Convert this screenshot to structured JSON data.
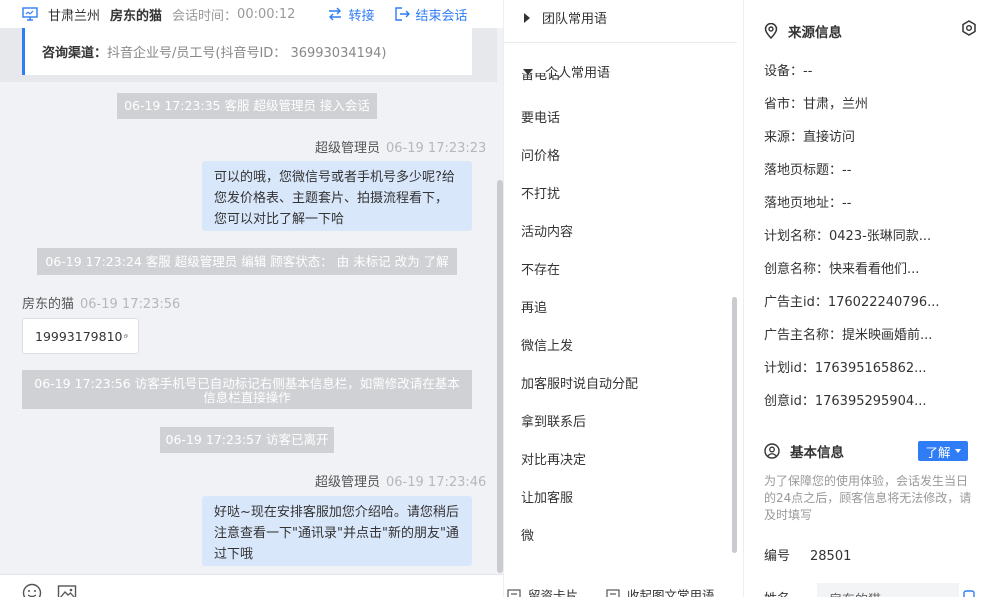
{
  "header": {
    "region": "甘肃兰州",
    "customer_name": "房东的猫",
    "session_time_label": "会话时间：",
    "session_time": "00:00:12",
    "transfer_label": "转接",
    "end_session_label": "结束会话"
  },
  "channel": {
    "label": "咨询渠道：",
    "value": "抖音企业号/员工号(抖音号ID： 36993034194)"
  },
  "messages": {
    "sys1": "06-19 17:23:35 客服 超级管理员 接入会话",
    "agent1": {
      "name": "超级管理员",
      "time": "06-19 17:23:23",
      "text": "可以的哦，您微信号或者手机号多少呢?给您发价格表、主题套片、拍摄流程看下，您可以对比了解一下哈"
    },
    "sys2": "06-19 17:23:24 客服 超级管理员 编辑 顾客状态： 由 未标记 改为 了解",
    "visitor1": {
      "name": "房东的猫",
      "time": "06-19 17:23:56",
      "text": "19993179810"
    },
    "sys3": "06-19 17:23:56 访客手机号已自动标记右侧基本信息栏，如需修改请在基本信息栏直接操作",
    "sys4": "06-19 17:23:57 访客已离开",
    "agent2": {
      "name": "超级管理员",
      "time": "06-19 17:23:46",
      "text": "好哒~现在安排客服加您介绍哈。请您稍后注意查看一下\"通讯录\"并点击\"新的朋友\"通过下哦"
    }
  },
  "phrases": {
    "team_group": "团队常用语",
    "personal_group": "个人常用语",
    "clipped_item": "留电话",
    "items": [
      "要电话",
      "问价格",
      "不打扰",
      "活动内容",
      "不存在",
      "再追",
      "微信上发",
      "加客服时说自动分配",
      "拿到联系后",
      "对比再决定",
      "让加客服",
      "微"
    ],
    "footer_left": "留资卡片",
    "footer_right": "收起图文常用语"
  },
  "source_info": {
    "title": "来源信息",
    "rows": [
      "设备：--",
      "省市：甘肃，兰州",
      "来源：直接访问",
      "落地页标题：--",
      "落地页地址：--",
      "计划名称：0423-张琳同款...",
      "创意名称：快来看看他们...",
      "广告主id：176022240796...",
      "广告主名称：提米映画婚前...",
      "计划id：176395165862...",
      "创意id：176395295904..."
    ]
  },
  "basic_info": {
    "title": "基本信息",
    "status_tag": "了解",
    "note": "为了保障您的使用体验，会话发生当日的24点之后，顾客信息将无法修改，请及时填写",
    "id_label": "编号",
    "id_value": "28501",
    "name_label": "姓名",
    "name_value": "房东的猫"
  },
  "colors": {
    "accent": "#2f7df6",
    "system_bg": "#cfd1d4",
    "agent_bubble": "#d9e7fb",
    "chat_bg": "#f0f2f5"
  },
  "icons": [
    "monitor-icon",
    "transfer-icon",
    "end-session-icon",
    "copy-icon",
    "emoji-icon",
    "image-icon",
    "location-icon",
    "settings-icon",
    "user-icon",
    "card-icon",
    "collapse-icon",
    "edit-icon"
  ]
}
